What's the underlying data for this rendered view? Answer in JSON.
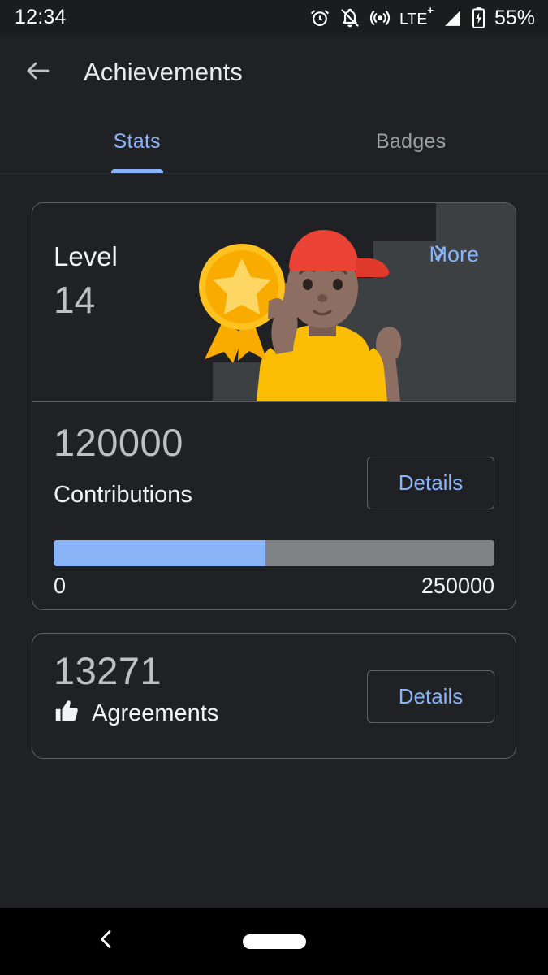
{
  "statusbar": {
    "time": "12:34",
    "battery_percent": "55%",
    "network_label": "LTE",
    "network_sup": "+",
    "icons": [
      "alarm-icon",
      "notifications-off-icon",
      "hotspot-icon",
      "signal-icon",
      "battery-charging-icon"
    ]
  },
  "appbar": {
    "back_icon": "back-arrow-icon",
    "title": "Achievements"
  },
  "tabs": [
    {
      "label": "Stats",
      "active": true
    },
    {
      "label": "Badges",
      "active": false
    }
  ],
  "level_card": {
    "level_word": "Level",
    "level_number": "14",
    "more_label": "More",
    "more_icon": "chevron-right-icon",
    "illustration": "person-holding-medal-on-stairs"
  },
  "contributions": {
    "value": "120000",
    "label": "Contributions",
    "details_label": "Details",
    "progress_min": "0",
    "progress_max": "250000",
    "progress_percent": 48
  },
  "agreements": {
    "value": "13271",
    "label": "Agreements",
    "icon": "thumbs-up-icon",
    "details_label": "Details"
  },
  "navbar": {
    "back_icon": "nav-back-icon",
    "home_pill": "home-indicator"
  },
  "colors": {
    "accent_blue": "#8ab4f8",
    "background": "#202124",
    "card_border": "#5f6368",
    "text_primary": "#f1f3f4",
    "text_secondary": "#bdc1c6",
    "text_muted": "#9aa0a6",
    "progress_track": "#7f8184",
    "medal_gold": "#f9ab00",
    "cap_red": "#ea4335",
    "shirt_yellow": "#fbbc04",
    "skin": "#8d6e63"
  }
}
